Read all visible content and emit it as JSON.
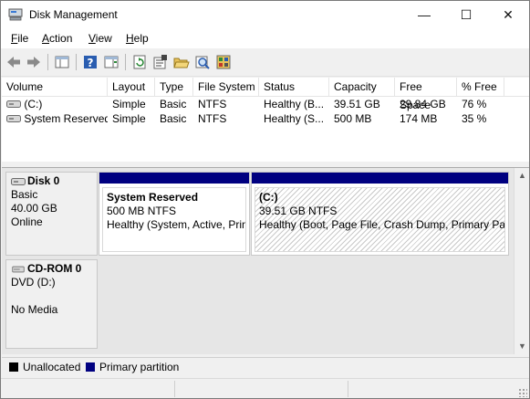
{
  "window": {
    "title": "Disk Management"
  },
  "title_controls": {
    "minimize": "—",
    "maximize": "☐",
    "close": "✕"
  },
  "menu": [
    {
      "key": "F",
      "rest": "ile"
    },
    {
      "key": "A",
      "rest": "ction"
    },
    {
      "key": "V",
      "rest": "iew"
    },
    {
      "key": "H",
      "rest": "elp"
    }
  ],
  "toolbar": {
    "icons": [
      "back-icon",
      "forward-icon",
      "console-tree-icon",
      "help-icon",
      "action-pane-icon",
      "refresh-icon",
      "properties-icon",
      "open-icon",
      "rescan-icon",
      "export-icon"
    ]
  },
  "volume_list": {
    "columns": [
      "Volume",
      "Layout",
      "Type",
      "File System",
      "Status",
      "Capacity",
      "Free Space",
      "% Free"
    ],
    "rows": [
      [
        "(C:)",
        "Simple",
        "Basic",
        "NTFS",
        "Healthy (B...",
        "39.51 GB",
        "29.84 GB",
        "76 %"
      ],
      [
        "System Reserved",
        "Simple",
        "Basic",
        "NTFS",
        "Healthy (S...",
        "500 MB",
        "174 MB",
        "35 %"
      ]
    ]
  },
  "disks": [
    {
      "name": "Disk 0",
      "type": "Basic",
      "size": "40.00 GB",
      "state": "Online",
      "partitions": [
        {
          "title": "System Reserved",
          "size_fs": "500 MB NTFS",
          "status": "Healthy (System, Active, Prin"
        },
        {
          "title": "(C:)",
          "size_fs": "39.51 GB NTFS",
          "status": "Healthy (Boot, Page File, Crash Dump, Primary Part"
        }
      ]
    },
    {
      "name": "CD-ROM 0",
      "type": "DVD (D:)",
      "media": "No Media"
    }
  ],
  "legend": [
    {
      "label": "Unallocated",
      "color": "#000000"
    },
    {
      "label": "Primary partition",
      "color": "#000080"
    }
  ],
  "colors": {
    "primary_partition": "#000080",
    "unallocated": "#000000"
  }
}
